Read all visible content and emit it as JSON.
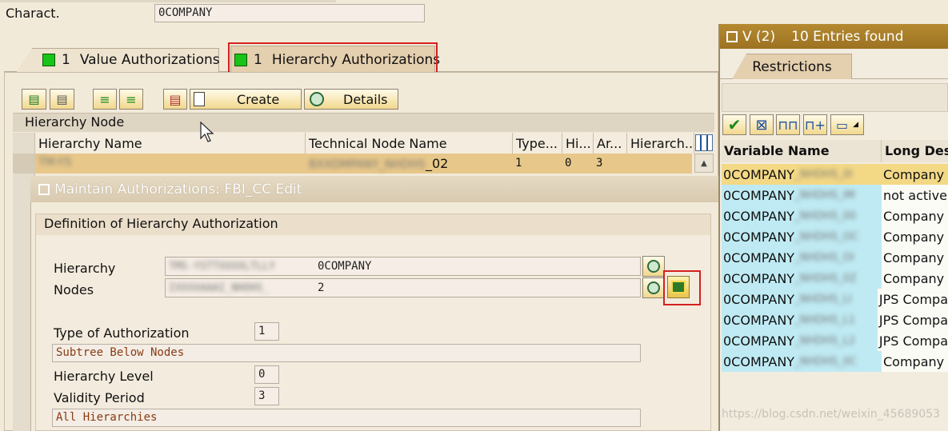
{
  "top": {
    "charact_label": "Charact.",
    "charact_value": "0COMPANY"
  },
  "tabs": [
    {
      "count": "1",
      "label": "Value Authorizations"
    },
    {
      "count": "1",
      "label": "Hierarchy Authorizations"
    }
  ],
  "toolbar": {
    "create_label": "Create",
    "details_label": "Details"
  },
  "hierarchy_node": {
    "section_title": "Hierarchy Node",
    "columns": [
      "Hierarchy Name",
      "Technical Node Name",
      "Type...",
      "Hi...",
      "Ar...",
      "Hierarch..."
    ],
    "row": {
      "name": "TM-YS",
      "technical": "BXXDMPANY_NHDHS",
      "technical_suffix": "_02",
      "type": "1",
      "hi": "0",
      "ar": "3",
      "hierarch": ""
    }
  },
  "dialog": {
    "title": "Maintain Authorizations: FBI_CC Edit",
    "group_title": "Definition of Hierarchy Authorization",
    "hierarchy_label": "Hierarchy",
    "hierarchy_blurred": "TMS-YSTTXXXXLTLLY",
    "hierarchy_value": "0COMPANY",
    "nodes_label": "Nodes",
    "nodes_blurred": "IXXXXAAAI_NHOHS_",
    "nodes_value": "2",
    "type_label": "Type of Authorization",
    "type_value": "1",
    "type_desc": "Subtree Below Nodes",
    "level_label": "Hierarchy Level",
    "level_value": "0",
    "validity_label": "Validity Period",
    "validity_value": "3",
    "validity_desc": "All Hierarchies"
  },
  "popup": {
    "title": "V (2)",
    "entries": "10 Entries found",
    "tab": "Restrictions",
    "col_variable": "Variable Name",
    "col_long": "Long Des",
    "rows": [
      {
        "var": "0COMPANY",
        "blur": "_NHDHS_0I",
        "long": "Company",
        "selected": true
      },
      {
        "var": "0COMPANY",
        "blur": "_NHDHS_IM",
        "long": "not active"
      },
      {
        "var": "0COMPANY",
        "blur": "_NHDHS_00",
        "long": "Company"
      },
      {
        "var": "0COMPANY",
        "blur": "_NHDHS_OC",
        "long": "Company"
      },
      {
        "var": "0COMPANY",
        "blur": "_NHDHS_OI",
        "long": "Company"
      },
      {
        "var": "0COMPANY",
        "blur": "_NHDHS_0Z",
        "long": "Company"
      },
      {
        "var": "0COMPANY",
        "blur": "_NHDHS_LI",
        "long": "JPS Compa"
      },
      {
        "var": "0COMPANY",
        "blur": "_NHDHS_L1",
        "long": "JPS Compa"
      },
      {
        "var": "0COMPANY",
        "blur": "_NHDHS_L2",
        "long": "JPS Compa"
      },
      {
        "var": "0COMPANY",
        "blur": "_NHDHS_0C",
        "long": "Company"
      }
    ]
  },
  "watermark": "https://blog.csdn.net/weixin_45689053",
  "colors": {
    "highlight_red": "#d42020",
    "popup_header": "#a87d28",
    "led_green": "#18c418"
  }
}
